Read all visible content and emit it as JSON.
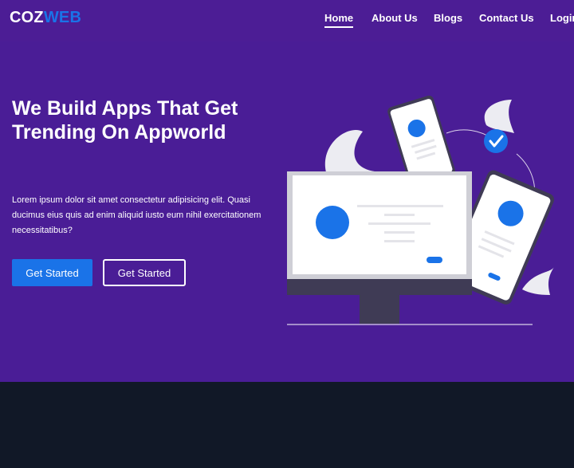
{
  "brand": {
    "part1": "COZ",
    "part2": "WEB"
  },
  "nav": {
    "items": [
      {
        "label": "Home",
        "active": true
      },
      {
        "label": "About Us",
        "active": false
      },
      {
        "label": "Blogs",
        "active": false
      },
      {
        "label": "Contact Us",
        "active": false
      },
      {
        "label": "Login",
        "active": false
      }
    ]
  },
  "hero": {
    "title": "We Build Apps That Get Trending On Appworld",
    "description": "Lorem ipsum dolor sit amet consectetur adipisicing elit. Quasi ducimus eius quis ad enim aliquid iusto eum nihil exercitationem necessitatibus?",
    "primary_button": "Get Started",
    "secondary_button": "Get Started"
  },
  "colors": {
    "navbar": "#4c1d95",
    "hero": "#4a1d96",
    "accent": "#1a73e8",
    "footer": "#111827"
  }
}
